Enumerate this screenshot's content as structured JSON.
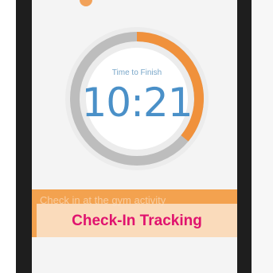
{
  "timer": {
    "caption": "Time to Finish",
    "value": "10:21",
    "progress": 0.36
  },
  "banner": {
    "text": "Check in at the gym activity"
  },
  "overlay_label": "Check-In Tracking",
  "colors": {
    "accent_orange": "#f3a24f",
    "timer_blue": "#4a90c8",
    "label_pink": "#e0126e"
  }
}
